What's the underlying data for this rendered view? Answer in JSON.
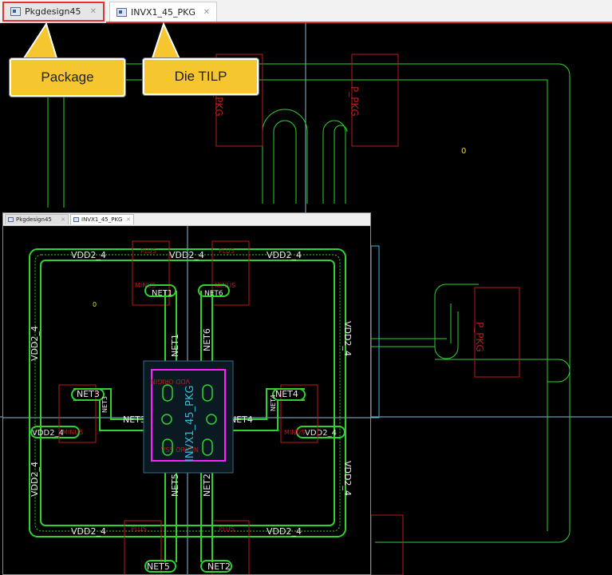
{
  "tabs": [
    {
      "label": "Pkgdesign45",
      "close": "✕"
    },
    {
      "label": "INVX1_45_PKG",
      "close": "✕"
    }
  ],
  "callouts": {
    "package": "Package",
    "die": "Die TILP"
  },
  "layout": {
    "top_pins": [
      "P_PKG",
      "P_PKG"
    ],
    "right_pins": [
      "P_PKG"
    ],
    "marker": "0"
  },
  "inset": {
    "tabs": [
      {
        "label": "Pkgdesign45",
        "close": "✕"
      },
      {
        "label": "INVX1_45_PKG",
        "close": "✕"
      }
    ],
    "ring_label": "VDD2_4",
    "die_name": "INVX1_45_PKG",
    "die_text_top": "VDD ORIGIN",
    "die_text_bottom": "VSS ORIGIN",
    "marker": "0",
    "nets": {
      "net1": "NET1",
      "net2": "NET2",
      "net3": "NET3",
      "net4": "NET4",
      "net5": "NET5",
      "net6": "NET6"
    },
    "pin_labels": {
      "plus": "PLUS",
      "minus": "MINUS",
      "pkg": "P_PKG"
    }
  },
  "colors": {
    "trace": "#2fd12f",
    "pin": "#b81c1c",
    "die": "#ff20ff",
    "die_text": "#38b8d8",
    "highlight": "#e03333",
    "callout": "#f5c62f"
  }
}
